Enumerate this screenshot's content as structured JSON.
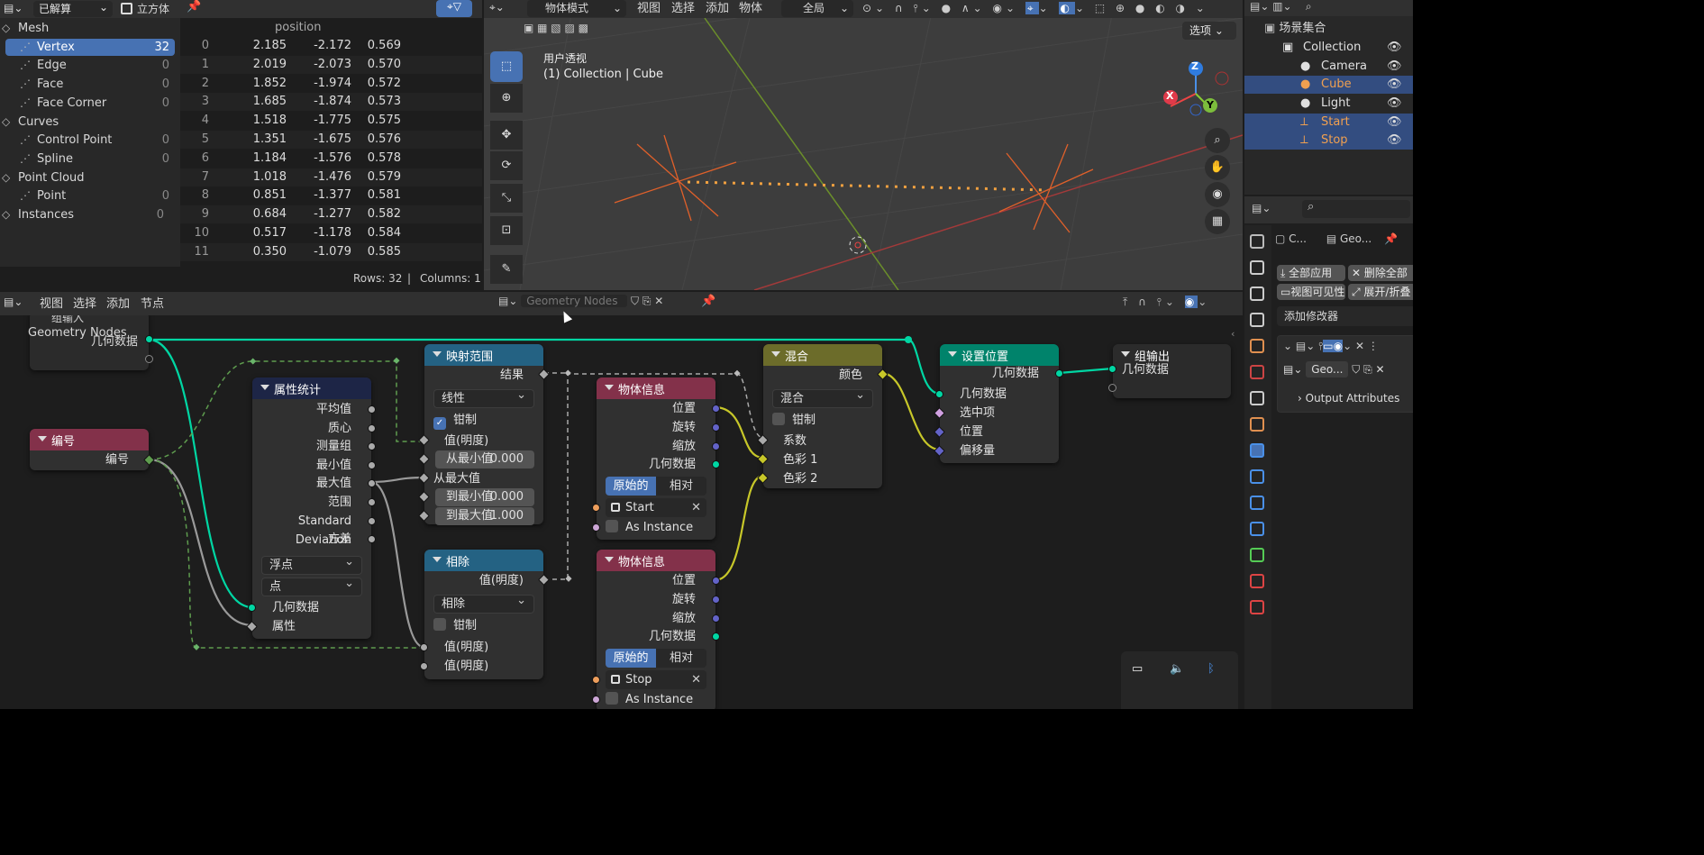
{
  "spreadsheet": {
    "header": {
      "mode": "已解算",
      "object": "立方体"
    },
    "tree": [
      {
        "label": "Mesh",
        "count": "",
        "indent": 0,
        "selected": false
      },
      {
        "label": "Vertex",
        "count": "32",
        "indent": 1,
        "selected": true
      },
      {
        "label": "Edge",
        "count": "0",
        "indent": 1,
        "selected": false
      },
      {
        "label": "Face",
        "count": "0",
        "indent": 1,
        "selected": false
      },
      {
        "label": "Face Corner",
        "count": "0",
        "indent": 1,
        "selected": false
      },
      {
        "label": "Curves",
        "count": "",
        "indent": 0,
        "selected": false
      },
      {
        "label": "Control Point",
        "count": "0",
        "indent": 1,
        "selected": false
      },
      {
        "label": "Spline",
        "count": "0",
        "indent": 1,
        "selected": false
      },
      {
        "label": "Point Cloud",
        "count": "",
        "indent": 0,
        "selected": false
      },
      {
        "label": "Point",
        "count": "0",
        "indent": 1,
        "selected": false
      },
      {
        "label": "Instances",
        "count": "0",
        "indent": 0,
        "selected": false
      }
    ],
    "column_header": "position",
    "rows": [
      [
        "0",
        "2.185",
        "-2.172",
        "0.569"
      ],
      [
        "1",
        "2.019",
        "-2.073",
        "0.570"
      ],
      [
        "2",
        "1.852",
        "-1.974",
        "0.572"
      ],
      [
        "3",
        "1.685",
        "-1.874",
        "0.573"
      ],
      [
        "4",
        "1.518",
        "-1.775",
        "0.575"
      ],
      [
        "5",
        "1.351",
        "-1.675",
        "0.576"
      ],
      [
        "6",
        "1.184",
        "-1.576",
        "0.578"
      ],
      [
        "7",
        "1.018",
        "-1.476",
        "0.579"
      ],
      [
        "8",
        "0.851",
        "-1.377",
        "0.581"
      ],
      [
        "9",
        "0.684",
        "-1.277",
        "0.582"
      ],
      [
        "10",
        "0.517",
        "-1.178",
        "0.584"
      ],
      [
        "11",
        "0.350",
        "-1.079",
        "0.585"
      ]
    ],
    "footer": {
      "rows": "Rows: 32",
      "sep": "|",
      "columns": "Columns: 1"
    }
  },
  "viewport": {
    "menu": {
      "mode": "物体模式",
      "view": "视图",
      "select": "选择",
      "add": "添加",
      "object": "物体",
      "orientation": "全局"
    },
    "options": "选项",
    "info_title": "用户透视",
    "info_sub": "(1) Collection | Cube",
    "gizmo": {
      "x": "X",
      "y": "Y",
      "z": "Z"
    }
  },
  "outliner": {
    "scene": "场景集合",
    "items": [
      {
        "label": "Collection",
        "color": "#e0e0e0",
        "selected": false
      },
      {
        "label": "Camera",
        "color": "#e0e0e0",
        "selected": false
      },
      {
        "label": "Cube",
        "color": "#f0a050",
        "selected": true
      },
      {
        "label": "Light",
        "color": "#e0e0e0",
        "selected": false
      },
      {
        "label": "Start",
        "color": "#f0a050",
        "selected": true
      },
      {
        "label": "Stop",
        "color": "#f0a050",
        "selected": true
      }
    ]
  },
  "properties": {
    "tab1": "C...",
    "tab2": "Geo...",
    "apply_all": "全部应用",
    "delete_all": "删除全部",
    "viewport_visible": "视图可见性",
    "expand": "展开/折叠",
    "add_modifier": "添加修改器",
    "modifier_name": "Geo...",
    "output_attributes": "Output Attributes"
  },
  "node_editor": {
    "menu": {
      "view": "视图",
      "select": "选择",
      "add": "添加",
      "node": "节点"
    },
    "tree_name": "Geometry Nodes",
    "group_input": {
      "title": "组输入",
      "label": "Geometry Nodes",
      "out": "几何数据"
    },
    "index": {
      "title": "编号",
      "out": "编号"
    },
    "attr_stats": {
      "title": "属性统计",
      "outputs": [
        "平均值",
        "质心",
        "测量组",
        "最小值",
        "最大值",
        "范围",
        "Standard Deviation",
        "方差"
      ],
      "type": "浮点",
      "domain": "点",
      "inputs": [
        "几何数据",
        "属性"
      ]
    },
    "map_range": {
      "title": "映射范围",
      "out": "结果",
      "interp": "线性",
      "clamp": "钳制",
      "value": "值(明度)",
      "from_min_label": "从最小值",
      "from_min": "0.000",
      "from_max": "从最大值",
      "to_min_label": "到最小值",
      "to_min": "0.000",
      "to_max_label": "到最大值",
      "to_max": "1.000"
    },
    "divide": {
      "title": "相除",
      "out": "值(明度)",
      "op": "相除",
      "clamp": "钳制",
      "in1": "值(明度)",
      "in2": "值(明度)"
    },
    "obj_info_1": {
      "title": "物体信息",
      "outputs": [
        "位置",
        "旋转",
        "缩放",
        "几何数据"
      ],
      "orig": "原始的",
      "rel": "相对",
      "object": "Start",
      "as_instance": "As Instance"
    },
    "obj_info_2": {
      "title": "物体信息",
      "outputs": [
        "位置",
        "旋转",
        "缩放",
        "几何数据"
      ],
      "orig": "原始的",
      "rel": "相对",
      "object": "Stop",
      "as_instance": "As Instance"
    },
    "mix": {
      "title": "混合",
      "out": "颜色",
      "mode": "混合",
      "clamp": "钳制",
      "inputs": [
        "系数",
        "色彩 1",
        "色彩 2"
      ]
    },
    "set_position": {
      "title": "设置位置",
      "out": "几何数据",
      "inputs": [
        "几何数据",
        "选中项",
        "位置",
        "偏移量"
      ]
    },
    "group_output": {
      "title": "组输出",
      "in": "几何数据"
    }
  },
  "colors": {
    "accent": "#4772b3",
    "selected_orange": "#f0a050",
    "geometry_socket": "#00d6a3",
    "input_header": "#83314a",
    "converter_header": "#246283",
    "geometry_header": "#00836b",
    "color_header": "#6c6c2a",
    "attr_header": "#1d2546"
  }
}
